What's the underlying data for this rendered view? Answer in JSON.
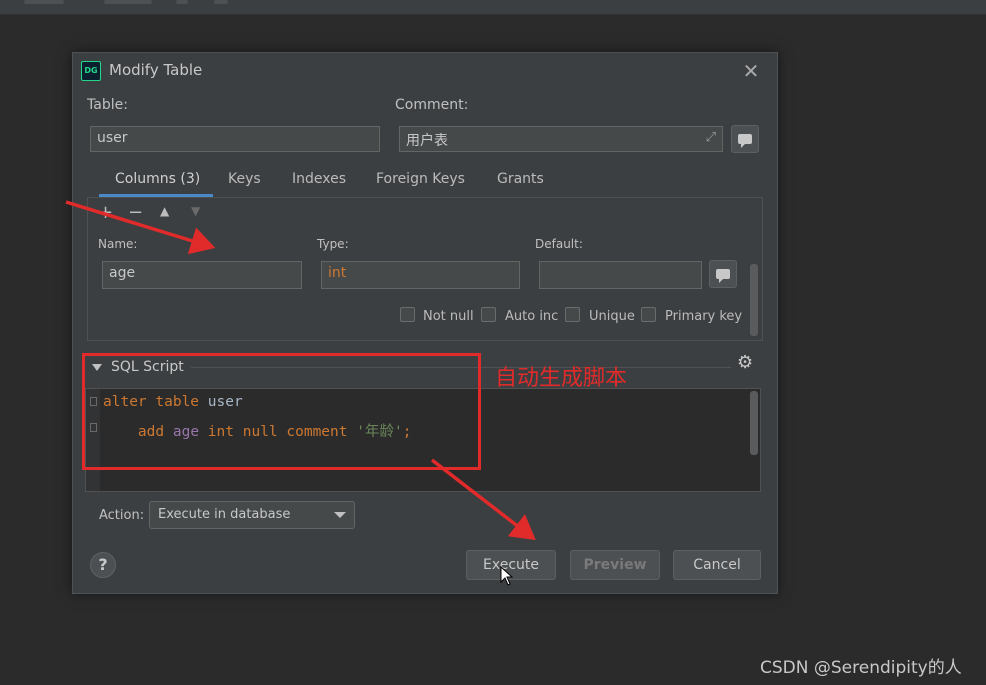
{
  "dialog": {
    "title": "Modify Table",
    "table_label": "Table:",
    "table_value": "user",
    "comment_label": "Comment:",
    "comment_value": "用户表"
  },
  "tabs": [
    "Columns (3)",
    "Keys",
    "Indexes",
    "Foreign Keys",
    "Grants"
  ],
  "column_editor": {
    "name_label": "Name:",
    "name_value": "age",
    "type_label": "Type:",
    "type_value": "int",
    "default_label": "Default:",
    "default_value": "",
    "checkboxes": [
      "Not null",
      "Auto inc",
      "Unique",
      "Primary key"
    ]
  },
  "sql": {
    "title": "SQL Script",
    "line1": {
      "kw1": "alter",
      "kw2": "table",
      "table": "user"
    },
    "line2": {
      "kw1": "add",
      "column": "age",
      "type": "int",
      "nullkw": "null",
      "commentkw": "comment",
      "string": "'年龄'",
      "semi": ";"
    }
  },
  "action": {
    "label": "Action:",
    "value": "Execute in database"
  },
  "buttons": {
    "help": "?",
    "execute": "Execute",
    "preview": "Preview",
    "cancel": "Cancel"
  },
  "annotation": {
    "text": "自动生成脚本",
    "color": "#e12b2b"
  },
  "watermark": "CSDN @Serendipity的人",
  "colors": {
    "keyword": "#cc7832",
    "identifier": "#a9b7c6",
    "column": "#9876aa",
    "string": "#6a8759",
    "accent": "#4a88c7"
  }
}
